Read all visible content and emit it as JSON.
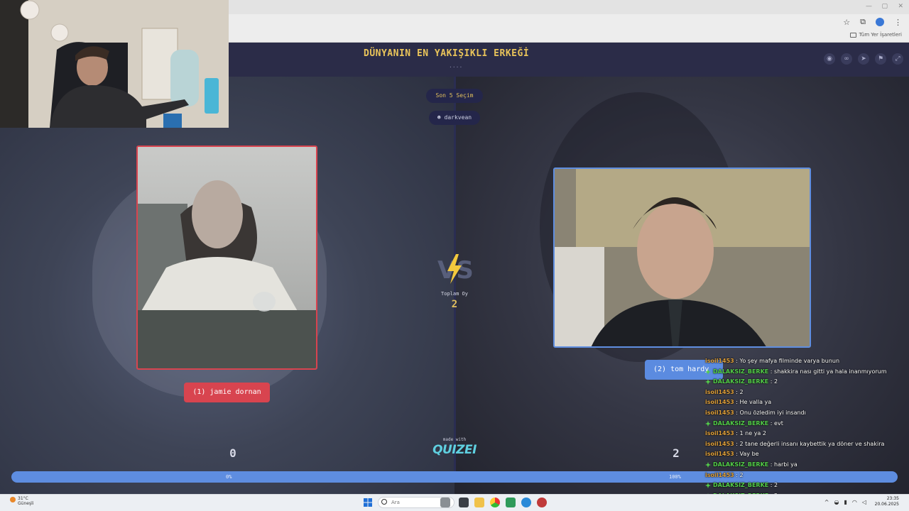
{
  "page": {
    "title": "DÜNYANIN EN YAKIŞIKLI ERKEĞİ",
    "title_dots": "....",
    "recent_pill": "Son 5 Seçim",
    "user_pill": "darkvean"
  },
  "bookmarks": {
    "all_bookmarks": "Tüm Yer İşaretleri"
  },
  "contestants": {
    "left": {
      "label": "(1) jamie dornan",
      "score": "0",
      "percent": "0%"
    },
    "right": {
      "label": "(2) tom hardy",
      "score": "2",
      "percent": "100%"
    }
  },
  "totals": {
    "label": "Toplam Oy",
    "value": "2",
    "right_share": 1.0
  },
  "branding": {
    "made_with": "made with",
    "name": "QUIZEI"
  },
  "chat": [
    {
      "user": "isoil1453",
      "message": "Yo şey mafya filminde varya bunun",
      "badge": false
    },
    {
      "user": "DALAKSIZ_BERKE",
      "message": "shakkira nası gitti ya hala inanmıyorum",
      "badge": true
    },
    {
      "user": "DALAKSIZ_BERKE",
      "message": "2",
      "badge": true
    },
    {
      "user": "isoil1453",
      "message": "2",
      "badge": false
    },
    {
      "user": "isoil1453",
      "message": "He valla ya",
      "badge": false
    },
    {
      "user": "isoil1453",
      "message": "Onu özledim iyi insandı",
      "badge": false
    },
    {
      "user": "DALAKSIZ_BERKE",
      "message": "evt",
      "badge": true
    },
    {
      "user": "isoil1453",
      "message": "1 ne ya 2",
      "badge": false
    },
    {
      "user": "isoil1453",
      "message": "2 tane değerli insanı kaybettik ya döner ve shakira",
      "badge": false
    },
    {
      "user": "isoil1453",
      "message": "Vay be",
      "badge": false
    },
    {
      "user": "DALAKSIZ_BERKE",
      "message": "harbi ya",
      "badge": true
    },
    {
      "user": "isoil1453",
      "message": "2",
      "badge": false
    },
    {
      "user": "DALAKSIZ_BERKE",
      "message": "2",
      "badge": true
    },
    {
      "user": "DALAKSIZ_BERKE",
      "message": "2",
      "badge": true
    },
    {
      "user": "isoil1453",
      "message": "2",
      "badge": false
    }
  ],
  "taskbar": {
    "temperature": "31°C",
    "weather_text": "Güneşli",
    "search_placeholder": "Ara",
    "time": "23:35",
    "date": "20.06.2025"
  },
  "colors": {
    "accent_gold": "#e9c45a",
    "left_red": "#d8444f",
    "right_blue": "#5f8ee0",
    "header_navy": "#2b2c48",
    "chat_user_orange": "#e0a03a",
    "chat_user_green": "#54d04a"
  },
  "icons": {
    "header": [
      "eye-icon",
      "link-icon",
      "send-icon",
      "flag-icon",
      "fullscreen-icon"
    ],
    "vs": "lightning-vs-icon"
  }
}
